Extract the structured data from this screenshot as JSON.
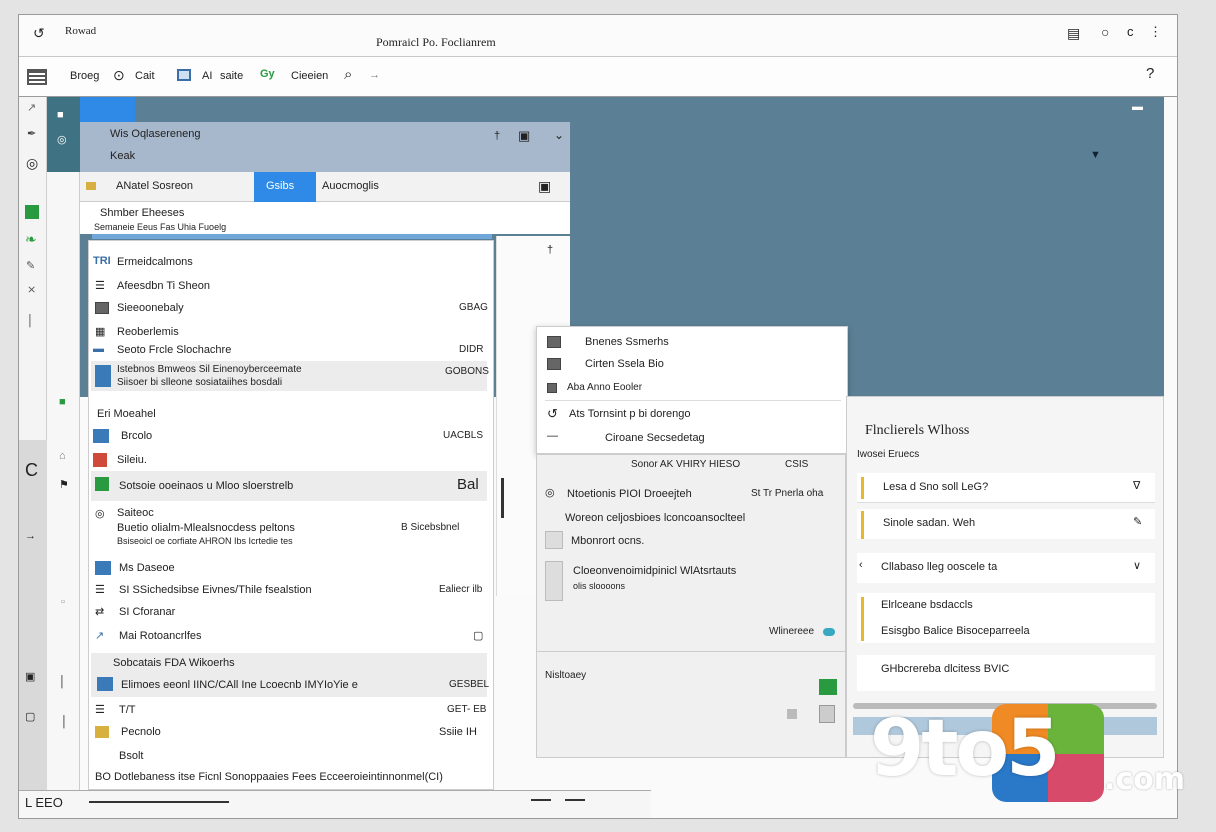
{
  "window": {
    "app_name": "Rowad",
    "title": "Pomraicl Po.  Foclianrem"
  },
  "toolbar": {
    "items": [
      "Broeg",
      "Cait",
      "AI",
      "saite",
      "Cieeien"
    ]
  },
  "nav_panel": {
    "header_line1": "Wis Oqlasereneng",
    "header_line2": "Keak",
    "tabs": [
      "ANatel Sosreon",
      "Gsibs",
      "Auocmoglis"
    ],
    "subheader": "Shmber Eheeses",
    "subheader2": "Semaneie Eeus Fas Uhia Fuoelg",
    "items": [
      {
        "label": "Ermeidcalmons",
        "value": ""
      },
      {
        "label": "Afeesdbn Ti Sheon",
        "value": ""
      },
      {
        "label": "Sieeoonebaly",
        "value": "GBAG"
      },
      {
        "label": "Reoberlemis",
        "value": ""
      },
      {
        "label": "Seoto Frcle Slochachre",
        "value": "DIDR"
      },
      {
        "label": "Istebnos Bmweos Sil Einenoyberceemate",
        "value": "GOBONS"
      },
      {
        "label": "Siisoer bi slleone sosiataiihes bosdali",
        "value": ""
      },
      {
        "label": "Eri Moeahel",
        "value": ""
      },
      {
        "label": "Brcolo",
        "value": "UACBLS"
      },
      {
        "label": "Sileiu.",
        "value": ""
      },
      {
        "label": "Sotsoie ooeinaos u Mloo sloerstrelb",
        "value": "Bal"
      },
      {
        "label": "Saiteoc",
        "value": ""
      },
      {
        "label": "Buetio olialm-Mlealsnocdess peltons",
        "value": "B Sicebsbnel"
      },
      {
        "label": "Bsiseoicl oe corfiate AHRON Ibs Icrtedie tes",
        "value": ""
      },
      {
        "label": "Ms Daseoe",
        "value": ""
      },
      {
        "label": "SI SSichedsibse Eivnes/Thile fsealstion",
        "value": "Ealiecr ilb"
      },
      {
        "label": "SI Cforanar",
        "value": ""
      },
      {
        "label": "Mai Rotoancrlfes",
        "value": ""
      },
      {
        "label": "Sobcatais FDA Wikoerhs",
        "value": ""
      },
      {
        "label": "Elimoes eeonl IINC/CAll Ine Lcoecnb IMYIoYie e",
        "value": "GESBEL"
      },
      {
        "label": "T/T",
        "value": "GET- EB"
      },
      {
        "label": "Pecnolo",
        "value": "Ssiie IH"
      },
      {
        "label": "Bsolt",
        "value": ""
      }
    ],
    "footer": "BO Dotlebaness itse Ficnl Sonoppaaies Fees Ecceeroieintinnonmel(CI)"
  },
  "context_menu": {
    "items": [
      "Bnenes Ssmerhs",
      "Cirten Ssela Bio",
      "Aba Anno Eooler",
      "Ats Tornsint p bi dorengo",
      "Ciroane Secsedetag"
    ]
  },
  "mid_panel": {
    "header": "Sonor AK VHIRY HIESO",
    "header_value": "CSIS",
    "items": [
      {
        "label": "Ntoetionis PIOI Droeejteh",
        "value": "St Tr Pnerla oha"
      },
      {
        "label": "Woreon celjosbioes lconcoansoclteel",
        "value": ""
      },
      {
        "label": "Mbonrort ocns.",
        "value": ""
      },
      {
        "label": "Cloeonvenoimidpinicl WlAtsrtauts",
        "value": ""
      },
      {
        "label": "olis sloooons",
        "value": ""
      },
      {
        "label": "Wlinereee",
        "value": ""
      },
      {
        "label": "Nisltoaey",
        "value": ""
      }
    ]
  },
  "right_panel": {
    "title": "Flnclierels Wlhoss",
    "subtitle": "Iwosei Eruecs",
    "items": [
      {
        "label": "Lesa d Sno soll LeG?"
      },
      {
        "label": "Sinole sadan. Weh"
      },
      {
        "label": "Cllabaso lleg ooscele ta"
      },
      {
        "label": "Elrlceane bsdaccls"
      },
      {
        "label": "Esisgbo Balice Bisoceparreela"
      },
      {
        "label": "GHbcrereba dlcitess BVIC"
      }
    ]
  },
  "statusbar": {
    "left": "L EEO"
  },
  "watermark": {
    "brand": "9to5",
    "suffix": ".com"
  },
  "colors": {
    "accent": "#2e8ae6",
    "desktop": "#5b8096",
    "yellow_marker": "#e8b82a",
    "green_icon": "#2a9a40"
  }
}
